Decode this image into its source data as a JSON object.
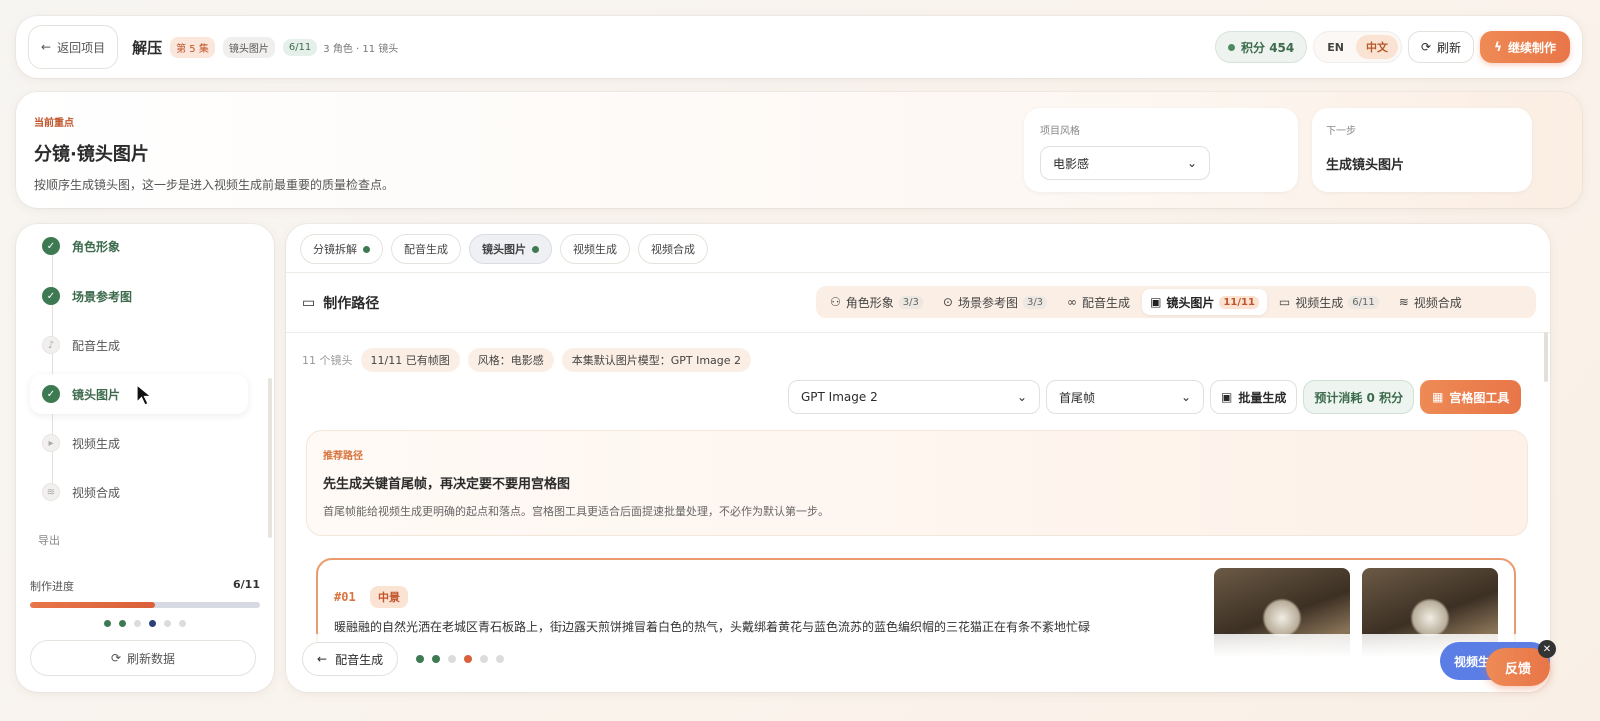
{
  "topbar": {
    "back_label": "返回项目",
    "title": "解压",
    "episode": "第 5 集",
    "stage": "镜头图片",
    "progress": "6/11",
    "meta": "3 角色 · 11 镜头",
    "points": "积分 454",
    "lang_en": "EN",
    "lang_zh": "中文",
    "refresh": "刷新",
    "continue": "继续制作"
  },
  "focus": {
    "label": "当前重点",
    "title": "分镜·镜头图片",
    "desc": "按顺序生成镜头图，这一步是进入视频生成前最重要的质量检查点。",
    "style_label": "项目风格",
    "style_value": "电影感",
    "next_label": "下一步",
    "next_value": "生成镜头图片"
  },
  "sidebar": {
    "steps": [
      {
        "label": "角色形象",
        "status": "done"
      },
      {
        "label": "场景参考图",
        "status": "done"
      },
      {
        "label": "配音生成",
        "status": "todo"
      },
      {
        "label": "镜头图片",
        "status": "done"
      },
      {
        "label": "视频生成",
        "status": "todo"
      },
      {
        "label": "视频合成",
        "status": "todo"
      }
    ],
    "export": "导出",
    "progress_label": "制作进度",
    "progress_value": "6/11",
    "progress_fraction": 0.545,
    "sync": "刷新数据"
  },
  "main": {
    "tabs": [
      {
        "label": "分镜拆解"
      },
      {
        "label": "配音生成"
      },
      {
        "label": "镜头图片"
      },
      {
        "label": "视频生成"
      },
      {
        "label": "视频合成"
      }
    ],
    "route_title": "制作路径",
    "route_tabs": [
      {
        "label": "角色形象",
        "count": "3/3"
      },
      {
        "label": "场景参考图",
        "count": "3/3"
      },
      {
        "label": "配音生成",
        "count": ""
      },
      {
        "label": "镜头图片",
        "count": "11/11"
      },
      {
        "label": "视频生成",
        "count": "6/11"
      },
      {
        "label": "视频合成",
        "count": ""
      }
    ],
    "shots_count": "11 个镜头",
    "chip_frames": "11/11  已有帧图",
    "chip_style": "风格：电影感",
    "chip_model": "本集默认图片模型：GPT Image 2",
    "model_select": "GPT Image 2",
    "frame_select": "首尾帧",
    "batch_btn": "批量生成",
    "estimate": "预计消耗 0 积分",
    "grid_btn": "宫格图工具",
    "recommend_label": "推荐路径",
    "recommend_title": "先生成关键首尾帧，再决定要不要用宫格图",
    "recommend_desc": "首尾帧能给视频生成更明确的起点和落点。宫格图工具更适合后面提速批量处理，不必作为默认第一步。",
    "shot": {
      "num": "#01",
      "tag": "中景",
      "desc": "暖融融的自然光洒在老城区青石板路上，街边露天煎饼摊冒着白色的热气，头戴绑着黄花与蓝色流苏的蓝色编织帽的三花猫正在有条不紊地忙碌"
    },
    "prev_btn": "配音生成",
    "video_btn": "视频生成",
    "feedback": "反馈"
  }
}
